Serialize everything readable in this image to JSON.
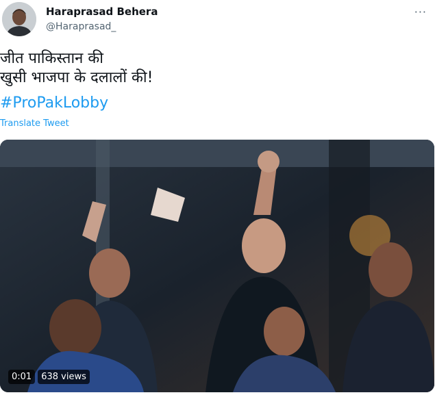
{
  "author": {
    "name": "Haraprasad Behera",
    "handle": "@Haraprasad_",
    "avatar_icon": "user-avatar-icon"
  },
  "menu_icon": "more-options-icon",
  "tweet": {
    "line1": "जीत पाकिस्तान की",
    "line2": "खुसी भाजपा के दलालों की!",
    "hashtag": "#ProPakLobby",
    "translate_label": "Translate Tweet"
  },
  "media": {
    "time": "0:01",
    "views": "638 views"
  },
  "colors": {
    "link": "#1d9bf0",
    "text": "#0f1419",
    "secondary": "#536471"
  }
}
